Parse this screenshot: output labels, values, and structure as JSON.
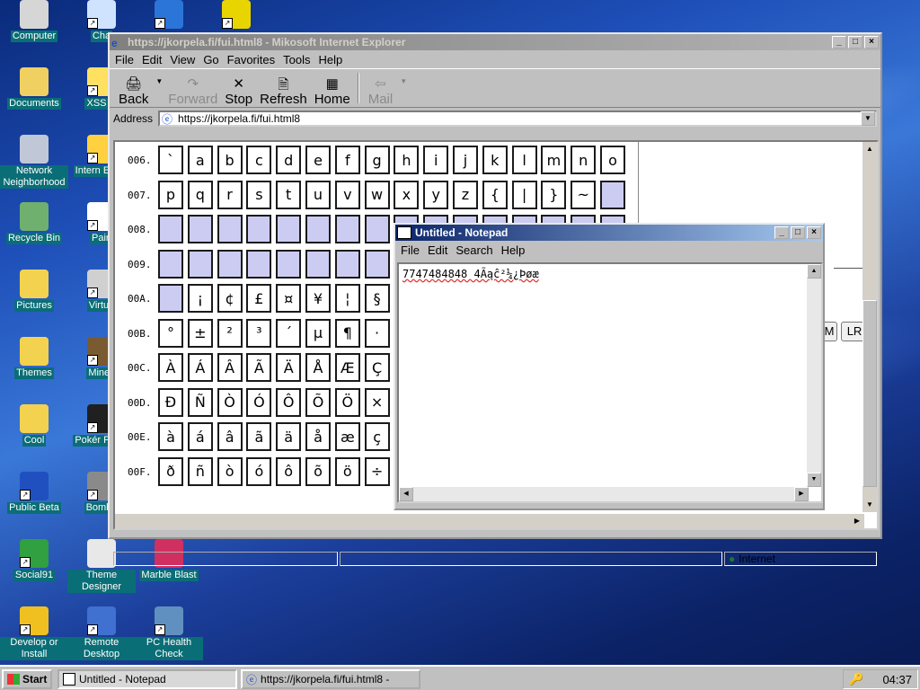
{
  "desktop": {
    "icons": [
      {
        "label": "Computer"
      },
      {
        "label": "Cha"
      },
      {
        "label": ""
      },
      {
        "label": ""
      },
      {
        "label": "Documents"
      },
      {
        "label": "XSS C"
      },
      {
        "label": "Network Neighborhood"
      },
      {
        "label": "Intern Explo"
      },
      {
        "label": "Recycle Bin"
      },
      {
        "label": "Pain"
      },
      {
        "label": "Pictures"
      },
      {
        "label": "Virtua"
      },
      {
        "label": "Themes"
      },
      {
        "label": "Minec"
      },
      {
        "label": "Cool"
      },
      {
        "label": "Pokér Platin"
      },
      {
        "label": "Public Beta"
      },
      {
        "label": "Bombe"
      },
      {
        "label": "Social91"
      },
      {
        "label": "Theme Designer"
      },
      {
        "label": "Marble Blast"
      },
      {
        "label": "Develop or Install"
      },
      {
        "label": "Remote Desktop"
      },
      {
        "label": "PC Health Check"
      }
    ]
  },
  "ie": {
    "title": "https://jkorpela.fi/fui.html8 - Mikosoft Internet Explorer",
    "menu": [
      "File",
      "Edit",
      "View",
      "Go",
      "Favorites",
      "Tools",
      "Help"
    ],
    "toolbar": {
      "back": "Back",
      "forward": "Forward",
      "stop": "Stop",
      "refresh": "Refresh",
      "home": "Home",
      "mail": "Mail"
    },
    "address_label": "Address",
    "address": "https://jkorpela.fi/fui.html8",
    "right_buttons": [
      "M",
      "LR"
    ],
    "status_zone": "Internet",
    "rows": [
      {
        "label": "006.",
        "cells": [
          "`",
          "a",
          "b",
          "c",
          "d",
          "e",
          "f",
          "g",
          "h",
          "i",
          "j",
          "k",
          "l",
          "m",
          "n",
          "o"
        ]
      },
      {
        "label": "007.",
        "cells": [
          "p",
          "q",
          "r",
          "s",
          "t",
          "u",
          "v",
          "w",
          "x",
          "y",
          "z",
          "{",
          "|",
          "}",
          "~",
          ""
        ]
      },
      {
        "label": "008.",
        "cells": [
          "",
          "",
          "",
          "",
          "",
          "",
          "",
          "",
          "",
          "",
          "",
          "",
          "",
          "",
          "",
          ""
        ]
      },
      {
        "label": "009.",
        "cells": [
          "",
          "",
          "",
          "",
          "",
          "",
          "",
          "",
          "",
          "",
          "",
          "",
          "",
          "",
          "",
          ""
        ]
      },
      {
        "label": "00A.",
        "cells": [
          "",
          "¡",
          "¢",
          "£",
          "¤",
          "¥",
          "¦",
          "§"
        ]
      },
      {
        "label": "00B.",
        "cells": [
          "°",
          "±",
          "²",
          "³",
          "´",
          "µ",
          "¶",
          "·"
        ]
      },
      {
        "label": "00C.",
        "cells": [
          "À",
          "Á",
          "Â",
          "Ã",
          "Ä",
          "Å",
          "Æ",
          "Ç"
        ]
      },
      {
        "label": "00D.",
        "cells": [
          "Ð",
          "Ñ",
          "Ò",
          "Ó",
          "Ô",
          "Õ",
          "Ö",
          "×"
        ]
      },
      {
        "label": "00E.",
        "cells": [
          "à",
          "á",
          "â",
          "ã",
          "ä",
          "å",
          "æ",
          "ç"
        ]
      },
      {
        "label": "00F.",
        "cells": [
          "ð",
          "ñ",
          "ò",
          "ó",
          "ô",
          "õ",
          "ö",
          "÷"
        ]
      }
    ]
  },
  "notepad": {
    "title": "Untitled - Notepad",
    "menu": [
      "File",
      "Edit",
      "Search",
      "Help"
    ],
    "text": "7747484848 4Ãąĉ²¼¿Þøæ"
  },
  "taskbar": {
    "start": "Start",
    "tasks": [
      "Untitled - Notepad",
      "https://jkorpela.fi/fui.html8 -"
    ],
    "clock": "04:37"
  }
}
